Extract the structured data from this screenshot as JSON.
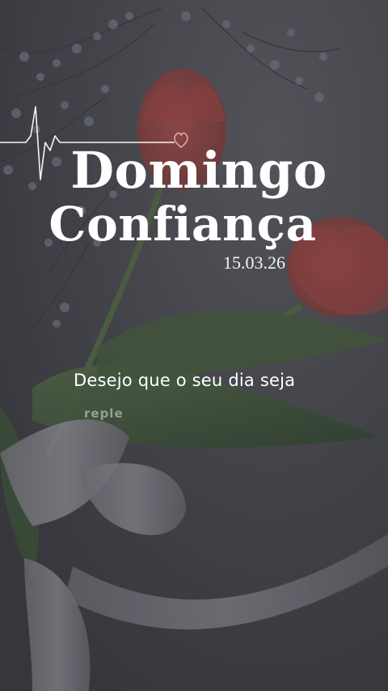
{
  "post": {
    "title_line1": "Domingo",
    "title_line2": "Confiança",
    "date": "15.03.26",
    "message": "Desejo que o seu dia seja",
    "message_continuation": "reple"
  },
  "decor": {
    "line_icon": "heartbeat-line-icon",
    "heart_icon": "heart-outline-icon",
    "accent_color": "#e8a0a6",
    "text_color": "#ffffff"
  }
}
